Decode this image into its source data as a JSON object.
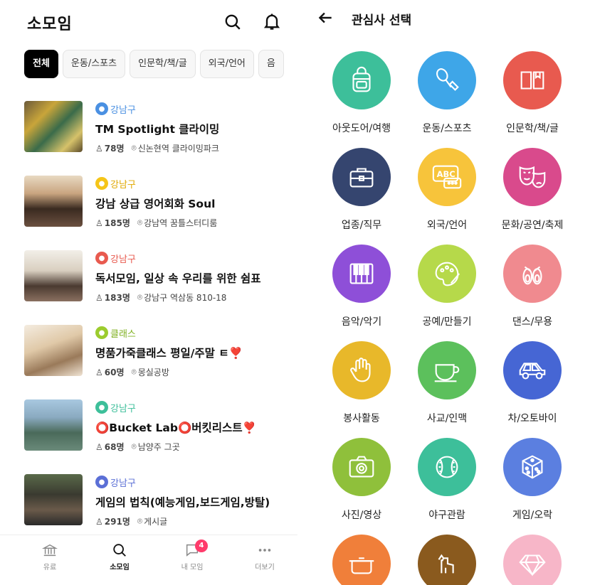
{
  "left": {
    "title": "소모임",
    "chips": [
      "전체",
      "운동/스포츠",
      "인문학/책/글",
      "외국/언어",
      "음"
    ],
    "groups": [
      {
        "category": "강남구",
        "cat_color": "#4a90e2",
        "name": "TM Spotlight 클라이밍",
        "members": "78명",
        "location": "신논현역 클라이밍파크"
      },
      {
        "category": "강남구",
        "cat_color": "#f5c518",
        "name": "강남 상급 영어회화 Soul",
        "members": "185명",
        "location": "강남역 꿈틀스터디룸"
      },
      {
        "category": "강남구",
        "cat_color": "#e85a4f",
        "name": "독서모임, 일상 속 우리를 위한 쉼표",
        "members": "183명",
        "location": "강남구 역삼동 810-18"
      },
      {
        "category": "클래스",
        "cat_color": "#9ccc2e",
        "name": "명품가죽클래스 평일/주말 ㅌ❣️",
        "members": "60명",
        "location": "몽실공방"
      },
      {
        "category": "강남구",
        "cat_color": "#3dbf9a",
        "name": "⭕Bucket Lab⭕버킷리스트❣️",
        "members": "68명",
        "location": "남양주 그곳"
      },
      {
        "category": "강남구",
        "cat_color": "#5b6fd6",
        "name": "게임의 법칙(예능게임,보드게임,방탈)",
        "members": "291명",
        "location": "게시글"
      }
    ],
    "tabs": [
      "유료",
      "소모임",
      "내 모임",
      "더보기"
    ],
    "badge": "4"
  },
  "right": {
    "title": "관심사 선택",
    "categories": [
      {
        "label": "아웃도어/여행",
        "color": "#3dbf9a",
        "icon": "backpack-icon"
      },
      {
        "label": "운동/스포츠",
        "color": "#3ea6e8",
        "icon": "badminton-icon"
      },
      {
        "label": "인문학/책/글",
        "color": "#e85a4f",
        "icon": "book-icon"
      },
      {
        "label": "업종/직무",
        "color": "#35456f",
        "icon": "briefcase-icon"
      },
      {
        "label": "외국/언어",
        "color": "#f7c43b",
        "icon": "speech-abc-icon"
      },
      {
        "label": "문화/공연/축제",
        "color": "#d94a8c",
        "icon": "theater-masks-icon"
      },
      {
        "label": "음악/악기",
        "color": "#8e4fd8",
        "icon": "piano-icon"
      },
      {
        "label": "공예/만들기",
        "color": "#b6d94a",
        "icon": "palette-icon"
      },
      {
        "label": "댄스/무용",
        "color": "#f08a8f",
        "icon": "ballet-shoes-icon"
      },
      {
        "label": "봉사활동",
        "color": "#e8b82a",
        "icon": "hand-icon"
      },
      {
        "label": "사교/인맥",
        "color": "#5cc05c",
        "icon": "cup-icon"
      },
      {
        "label": "차/오토바이",
        "color": "#4666d4",
        "icon": "car-icon"
      },
      {
        "label": "사진/영상",
        "color": "#8fc03b",
        "icon": "camera-icon"
      },
      {
        "label": "야구관람",
        "color": "#3dbf9a",
        "icon": "baseball-icon"
      },
      {
        "label": "게임/오락",
        "color": "#5b7fe0",
        "icon": "dice-icon"
      },
      {
        "label": "",
        "color": "#f07f3a",
        "icon": "pot-icon"
      },
      {
        "label": "",
        "color": "#8a5a1e",
        "icon": "dog-icon"
      },
      {
        "label": "",
        "color": "#f7b6c8",
        "icon": "diamond-icon"
      }
    ]
  }
}
